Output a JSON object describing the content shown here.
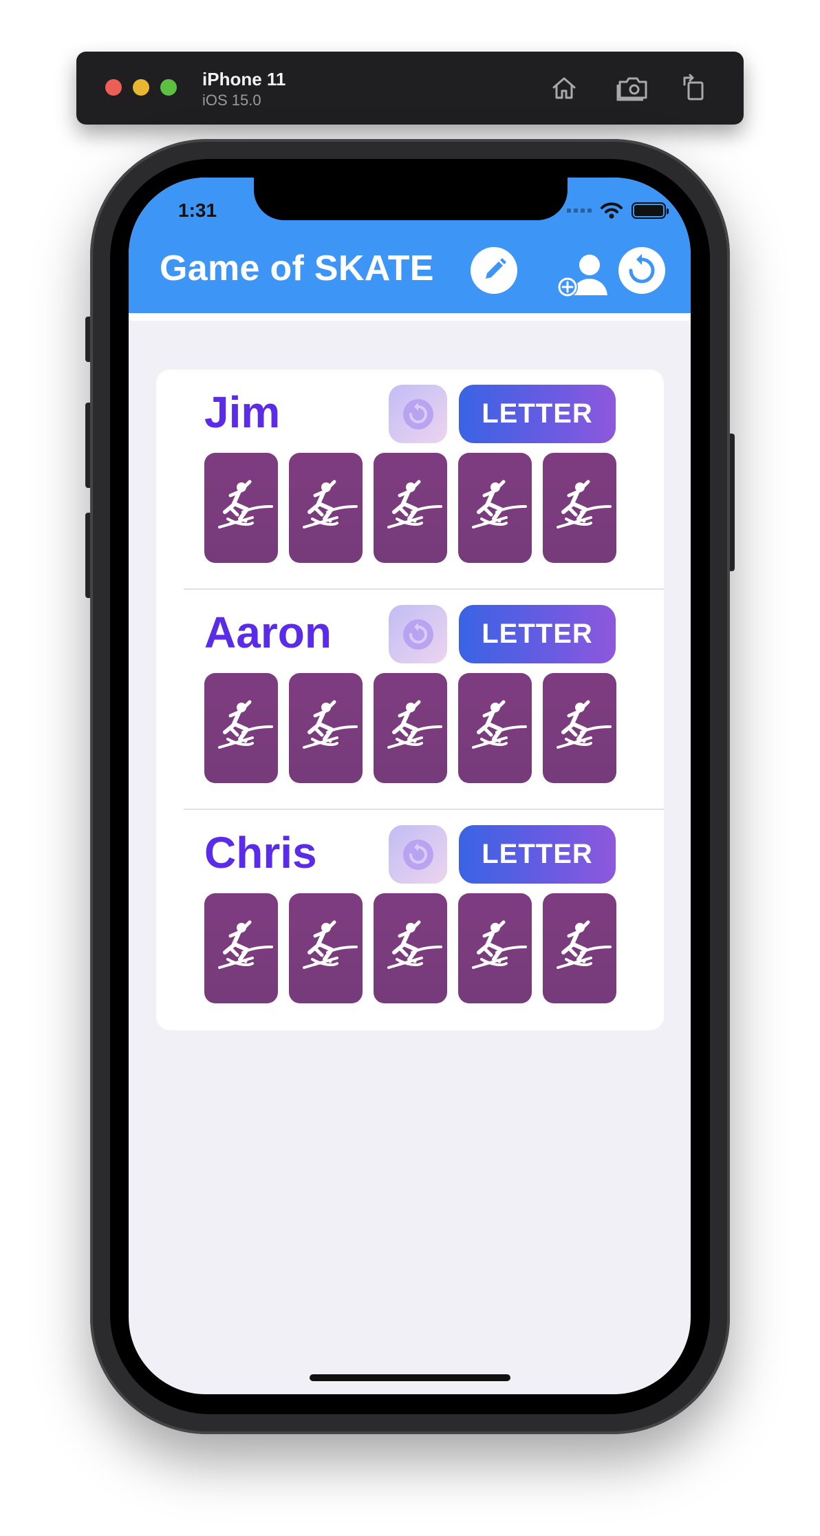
{
  "simulator": {
    "device_name": "iPhone 11",
    "os_version": "iOS 15.0",
    "toolbar_icons": [
      "home-icon",
      "screenshot-icon",
      "rotate-icon"
    ]
  },
  "status_bar": {
    "time": "1:31",
    "icons": [
      "cellular-signal-icon",
      "wifi-icon",
      "battery-icon"
    ]
  },
  "header": {
    "title": "Game of SKATE",
    "buttons": [
      "edit-pencil-icon",
      "add-player-icon",
      "reset-game-icon"
    ],
    "background_color": "#3d96f5"
  },
  "players": [
    {
      "name": "Jim",
      "undo_icon": "undo-icon",
      "letter_label": "LETTER",
      "letters_given": 0,
      "tile_icon": "skater-icon"
    },
    {
      "name": "Aaron",
      "undo_icon": "undo-icon",
      "letter_label": "LETTER",
      "letters_given": 0,
      "tile_icon": "skater-icon"
    },
    {
      "name": "Chris",
      "undo_icon": "undo-icon",
      "letter_label": "LETTER",
      "letters_given": 0,
      "tile_icon": "skater-icon"
    }
  ],
  "colors": {
    "player_name": "#5a2be8",
    "tile": "#7a3b7d",
    "letter_gradient_start": "#3a63e4",
    "letter_gradient_end": "#8e58dc"
  }
}
